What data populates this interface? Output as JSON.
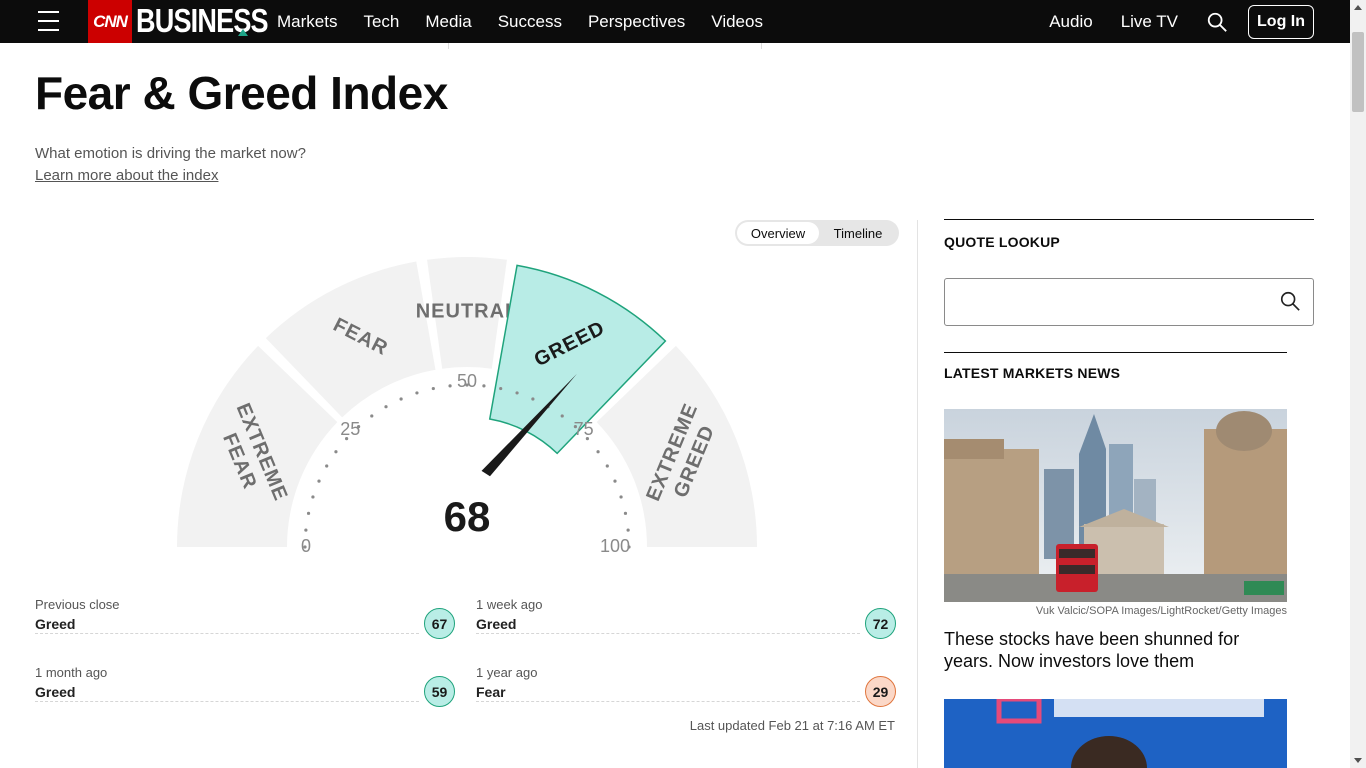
{
  "nav": {
    "brand_cnn": "CNN",
    "brand_business": "BUSINESS",
    "links": [
      "Markets",
      "Tech",
      "Media",
      "Success",
      "Perspectives",
      "Videos"
    ],
    "right_links": [
      "Audio",
      "Live TV"
    ],
    "login_label": "Log In"
  },
  "header": {
    "title": "Fear & Greed Index",
    "subtitle": "What emotion is driving the market now?",
    "learn_more": "Learn more about the index"
  },
  "view_toggle": {
    "options": [
      "Overview",
      "Timeline"
    ],
    "selected": "Overview"
  },
  "gauge": {
    "value": 68,
    "segments": [
      {
        "lines": [
          "EXTREME",
          "FEAR"
        ],
        "min": 0,
        "max": 25
      },
      {
        "lines": [
          "FEAR"
        ],
        "min": 25,
        "max": 45
      },
      {
        "lines": [
          "NEUTRAL"
        ],
        "min": 45,
        "max": 55
      },
      {
        "lines": [
          "GREED"
        ],
        "min": 55,
        "max": 75
      },
      {
        "lines": [
          "EXTREME",
          "GREED"
        ],
        "min": 75,
        "max": 100
      }
    ],
    "active_segment": "GREED",
    "tick_labels": [
      "0",
      "25",
      "50",
      "75",
      "100"
    ],
    "colors": {
      "active_fill": "#b8ece6",
      "active_border": "#1fa37c",
      "segment_fill": "#f2f2f2",
      "needle": "#1a1a1a"
    }
  },
  "history": [
    {
      "label": "Previous close",
      "rating": "Greed",
      "value": "67",
      "kind": "greed"
    },
    {
      "label": "1 week ago",
      "rating": "Greed",
      "value": "72",
      "kind": "greed"
    },
    {
      "label": "1 month ago",
      "rating": "Greed",
      "value": "59",
      "kind": "greed"
    },
    {
      "label": "1 year ago",
      "rating": "Fear",
      "value": "29",
      "kind": "fear"
    }
  ],
  "last_updated": "Last updated Feb 21 at 7:16 AM ET",
  "rail": {
    "quote_lookup_title": "QUOTE LOOKUP",
    "quote_input_value": "",
    "latest_news_title": "LATEST MARKETS NEWS",
    "article": {
      "credit": "Vuk Valcic/SOPA Images/LightRocket/Getty Images",
      "headline": "These stocks have been shunned for years. Now investors love them"
    }
  }
}
